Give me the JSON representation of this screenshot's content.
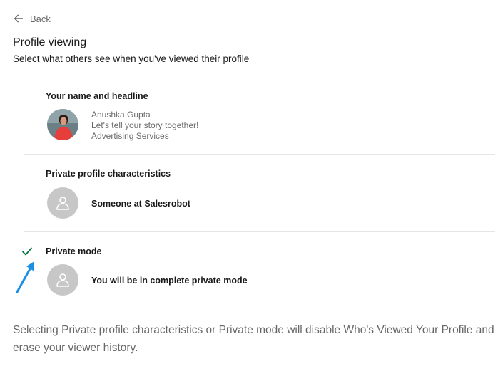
{
  "back": {
    "label": "Back",
    "icon": "arrow-left-icon"
  },
  "header": {
    "title": "Profile viewing",
    "subtitle": "Select what others see when you've viewed their profile"
  },
  "options": [
    {
      "heading": "Your name and headline",
      "name": "Anushka Gupta",
      "headline": "Let's tell your story together!",
      "industry": "Advertising Services",
      "selected": false
    },
    {
      "heading": "Private profile characteristics",
      "text": "Someone at Salesrobot",
      "selected": false
    },
    {
      "heading": "Private mode",
      "text": "You will be in complete private mode",
      "selected": true
    }
  ],
  "footer": "Selecting Private profile characteristics or Private mode will disable Who's Viewed Your Profile and erase your viewer history.",
  "colors": {
    "check": "#057642",
    "annotation_arrow": "#1a8fe6",
    "ghost_avatar": "#c7c7c7"
  }
}
